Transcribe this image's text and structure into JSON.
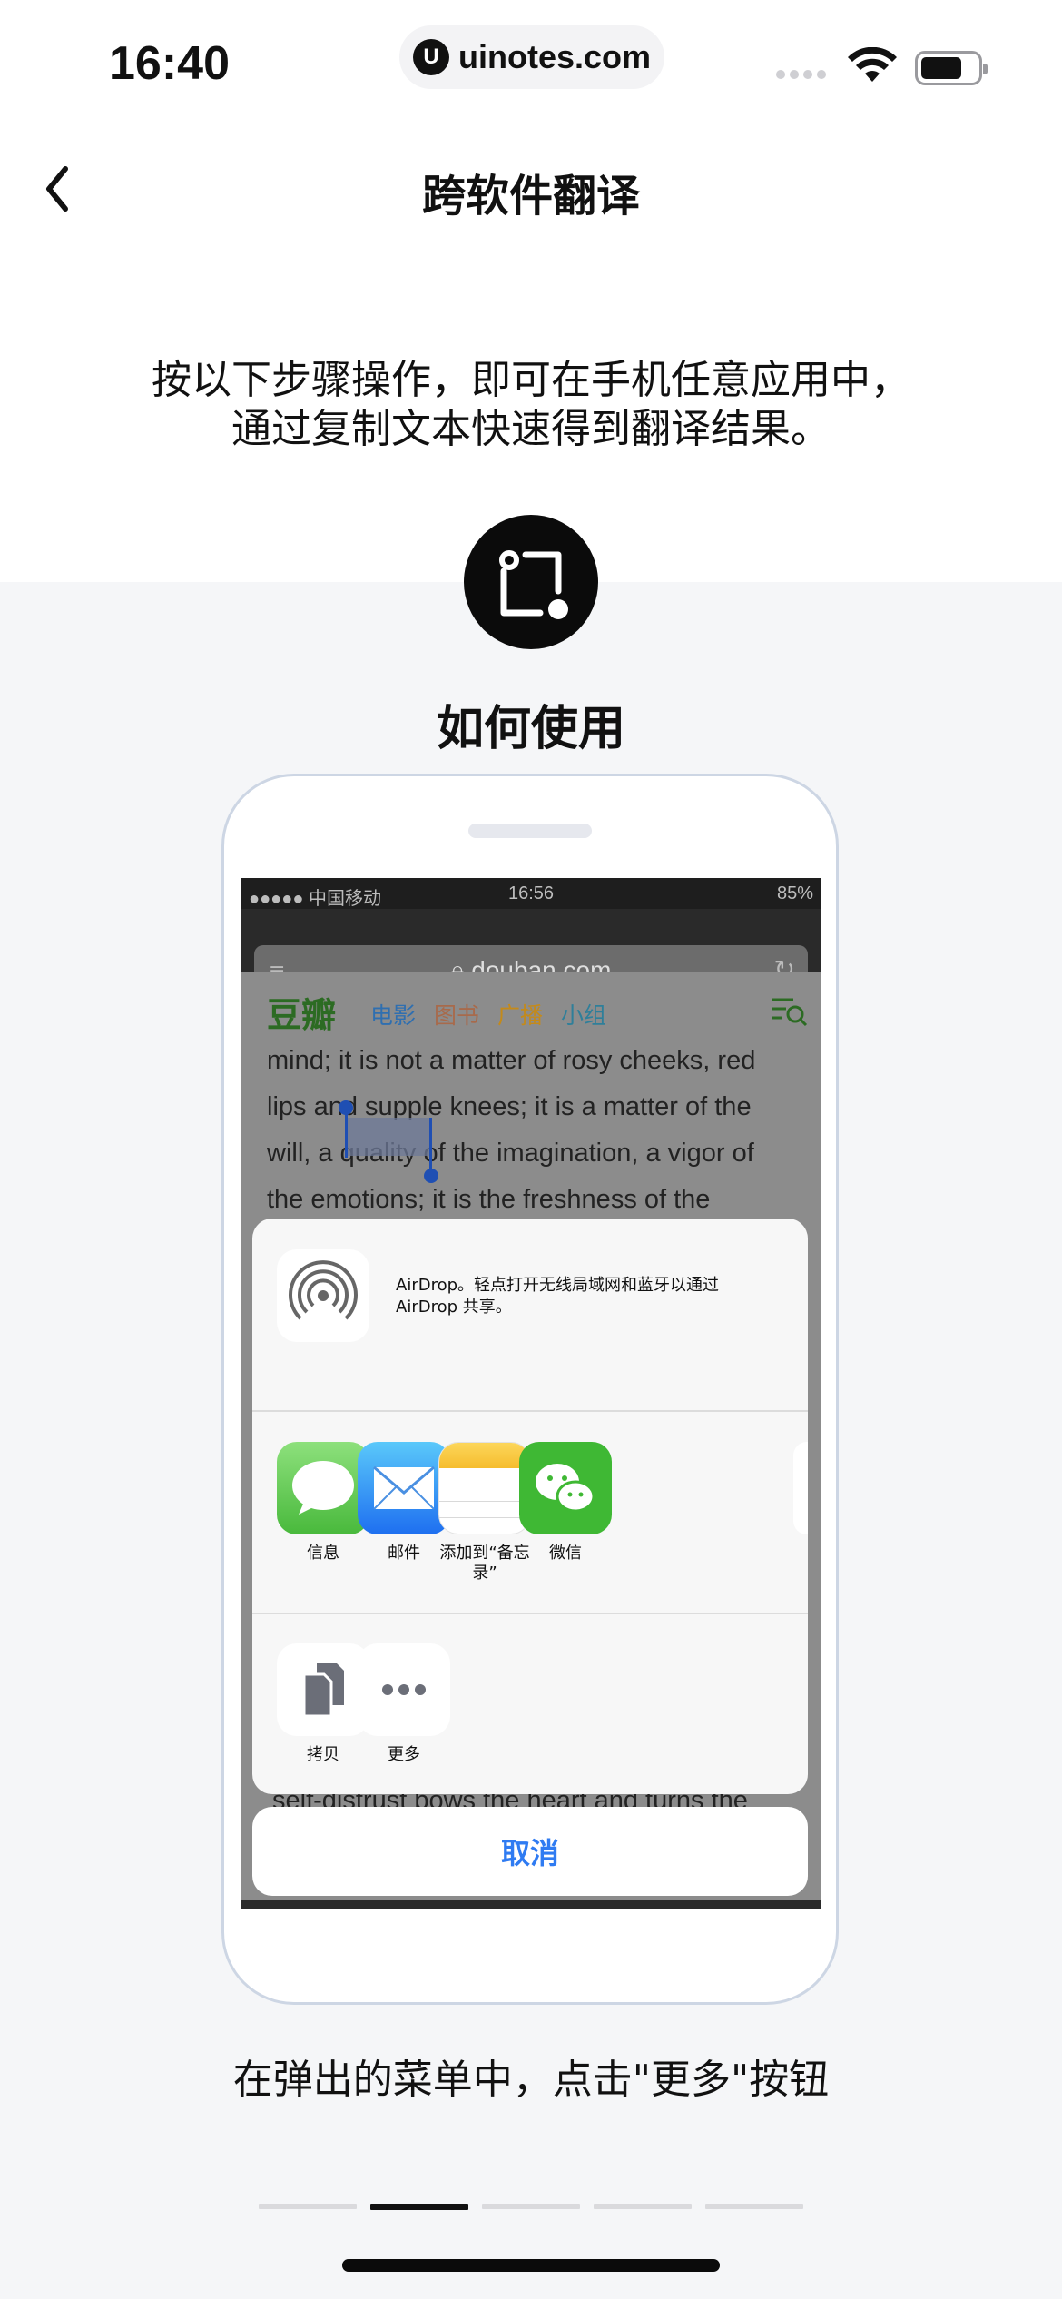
{
  "status_bar": {
    "time": "16:40",
    "site_label": "uinotes.com"
  },
  "nav": {
    "title": "跨软件翻译"
  },
  "intro": {
    "line1": "按以下步骤操作，即可在手机任意应用中，",
    "line2": "通过复制文本快速得到翻译结果。"
  },
  "section": {
    "heading": "如何使用"
  },
  "mock_screen": {
    "status_left": "●●●●● 中国移动",
    "status_time": "16:56",
    "status_right": "85%",
    "url": "douban.com",
    "logo": "豆瓣",
    "nav_items": [
      {
        "label": "电影",
        "color": "#2f6fb0"
      },
      {
        "label": "图书",
        "color": "#a86a4b"
      },
      {
        "label": "广播",
        "color": "#c48a1a"
      },
      {
        "label": "小组",
        "color": "#2f7f9a"
      }
    ],
    "article_lines": [
      "mind; it is not a matter of rosy cheeks, red",
      "lips and supple knees; it is a matter of the",
      "will, a quality of the imagination, a vigor of",
      "the emotions; it is the freshness of the"
    ],
    "peek_line": "self-distrust bows the heart and turns the",
    "airdrop_text": "AirDrop。轻点打开无线局域网和蓝牙以通过AirDrop 共享。",
    "share_apps": [
      "信息",
      "邮件",
      "添加到“备忘录”",
      "微信"
    ],
    "action_items": [
      "拷贝",
      "更多"
    ],
    "cancel_label": "取消"
  },
  "caption": "在弹出的菜单中，点击\"更多\"按钮",
  "pager": {
    "total": 5,
    "active_index": 1
  },
  "colors": {
    "accent_blue": "#2f7bf2",
    "douban_green": "#2c6b23"
  }
}
